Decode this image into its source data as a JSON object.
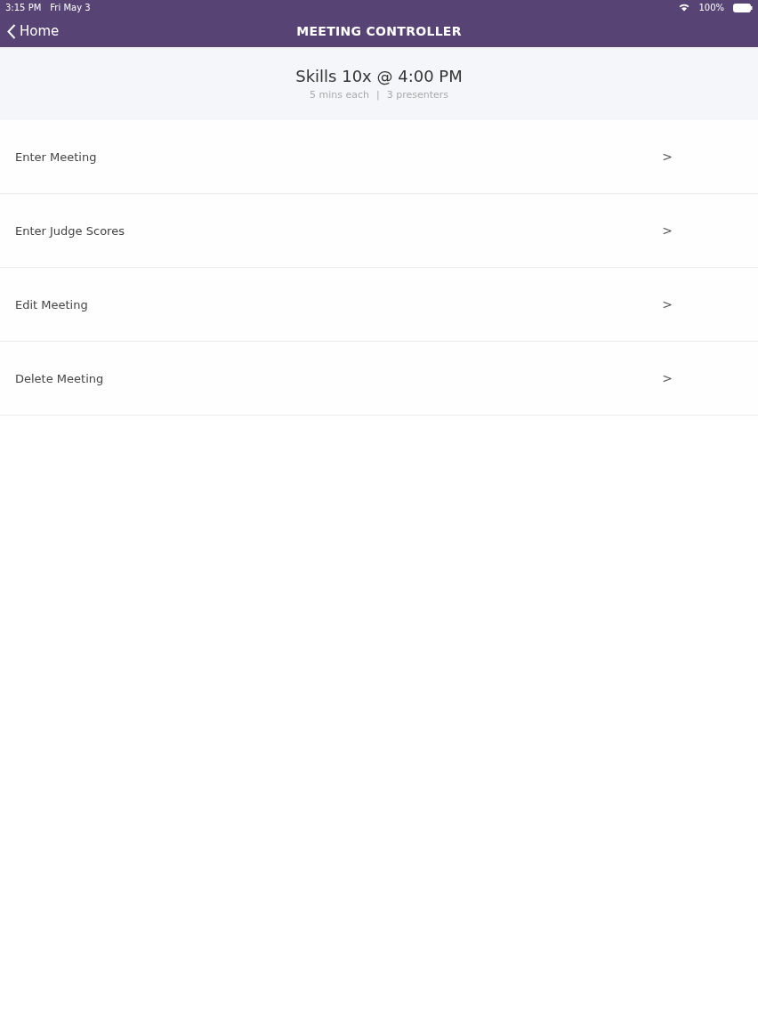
{
  "status_bar": {
    "time": "3:15 PM",
    "date": "Fri May 3",
    "battery": "100%"
  },
  "nav_bar": {
    "back_label": "Home",
    "title": "MEETING CONTROLLER"
  },
  "header": {
    "title": "Skills 10x @ 4:00 PM",
    "details": [
      "5 mins each",
      "3 presenters"
    ],
    "separator": "|"
  },
  "menu_items": [
    {
      "label": "Enter Meeting",
      "chevron": ">"
    },
    {
      "label": "Enter Judge Scores",
      "chevron": ">"
    },
    {
      "label": "Edit Meeting",
      "chevron": ">"
    },
    {
      "label": "Delete Meeting",
      "chevron": ">"
    }
  ]
}
